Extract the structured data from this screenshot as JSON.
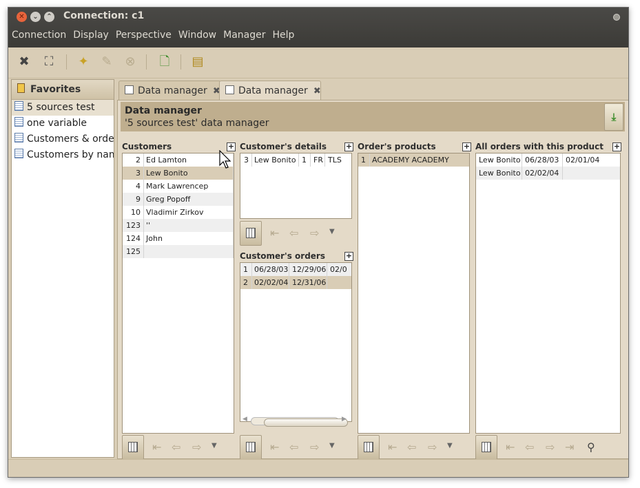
{
  "window": {
    "title": "Connection: c1"
  },
  "menu": [
    "Connection",
    "Display",
    "Perspective",
    "Window",
    "Manager",
    "Help"
  ],
  "favorites": {
    "title": "Favorites",
    "items": [
      "5 sources test",
      "one variable",
      "Customers & orders",
      "Customers by name"
    ]
  },
  "tabs": [
    {
      "label": "Data manager"
    },
    {
      "label": "Data manager"
    }
  ],
  "data_manager": {
    "title": "Data manager",
    "subtitle": "'5 sources test' data manager"
  },
  "customers": {
    "title": "Customers",
    "rows": [
      {
        "id": "2",
        "name": "Ed Lamton"
      },
      {
        "id": "3",
        "name": "Lew Bonito"
      },
      {
        "id": "4",
        "name": "Mark Lawrencep"
      },
      {
        "id": "9",
        "name": "Greg Popoff"
      },
      {
        "id": "10",
        "name": "Vladimir Zirkov"
      },
      {
        "id": "123",
        "name": "''"
      },
      {
        "id": "124",
        "name": "John"
      },
      {
        "id": "125",
        "name": ""
      }
    ]
  },
  "customer_details": {
    "title": "Customer's details",
    "row": {
      "id": "3",
      "name": "Lew Bonito",
      "n": "1",
      "country": "FR",
      "city": "TLS"
    }
  },
  "customer_orders": {
    "title": "Customer's orders",
    "rows": [
      {
        "n": "1",
        "d1": "06/28/03",
        "d2": "12/29/06",
        "d3": "02/0"
      },
      {
        "n": "2",
        "d1": "02/02/04",
        "d2": "12/31/06",
        "d3": ""
      }
    ]
  },
  "order_products": {
    "title": "Order's products",
    "rows": [
      {
        "n": "1",
        "name": "ACADEMY ACADEMY"
      }
    ]
  },
  "all_orders": {
    "title": "All orders with this product",
    "rows": [
      {
        "name": "Lew Bonito",
        "d1": "06/28/03",
        "d2": "02/01/04"
      },
      {
        "name": "Lew Bonito",
        "d1": "02/02/04",
        "d2": ""
      }
    ]
  }
}
